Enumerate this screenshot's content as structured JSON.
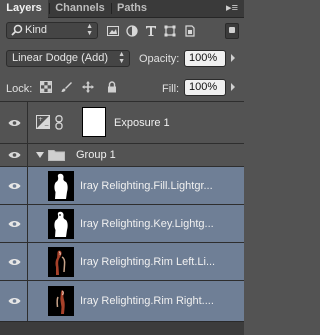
{
  "tabs": [
    {
      "label": "Layers"
    },
    {
      "label": "Channels"
    },
    {
      "label": "Paths"
    }
  ],
  "filter": {
    "kind_label": "Kind"
  },
  "blend": {
    "mode": "Linear Dodge (Add)",
    "opacity_label": "Opacity:",
    "opacity_value": "100%"
  },
  "lock": {
    "label": "Lock:",
    "fill_label": "Fill:",
    "fill_value": "100%"
  },
  "layers": [
    {
      "name": "Exposure 1"
    },
    {
      "name": "Group 1"
    },
    {
      "name": "Iray Relighting.Fill.Lightgr..."
    },
    {
      "name": "Iray Relighting.Key.Lightg..."
    },
    {
      "name": "Iray Relighting.Rim Left.Li..."
    },
    {
      "name": "Iray Relighting.Rim Right...."
    }
  ],
  "colors": {
    "panel": "#535353",
    "selected_row": "#6f7f96",
    "tab_bar": "#3a3a3a"
  }
}
